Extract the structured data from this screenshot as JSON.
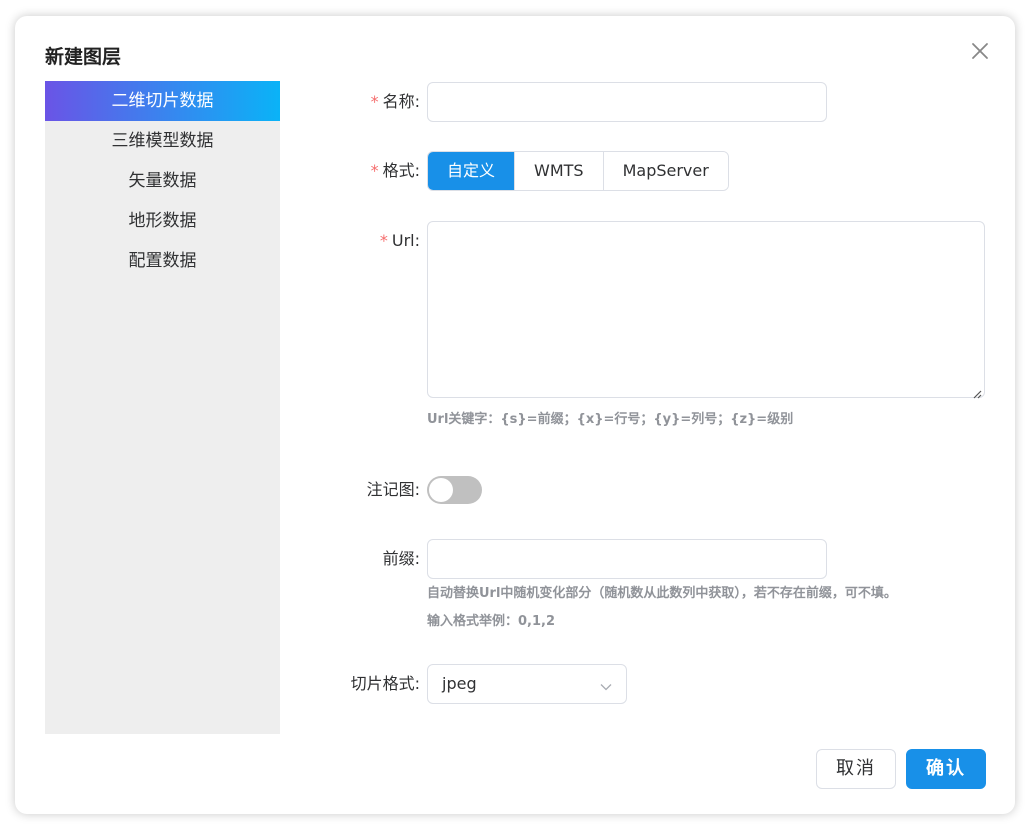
{
  "dialog": {
    "title": "新建图层",
    "close_icon": "close-icon"
  },
  "sidebar": {
    "items": [
      {
        "label": "二维切片数据",
        "active": true
      },
      {
        "label": "三维模型数据",
        "active": false
      },
      {
        "label": "矢量数据",
        "active": false
      },
      {
        "label": "地形数据",
        "active": false
      },
      {
        "label": "配置数据",
        "active": false
      }
    ],
    "active_gradient": [
      "#6a54e6",
      "#0ab3f7"
    ]
  },
  "form": {
    "required_mark": "*",
    "name": {
      "label": "名称:",
      "value": ""
    },
    "format": {
      "label": "格式:",
      "options": [
        "自定义",
        "WMTS",
        "MapServer"
      ],
      "selected": "自定义"
    },
    "url": {
      "label": "Url:",
      "value": "",
      "hint": "Url关键字：{s}=前缀；{x}=行号；{y}=列号；{z}=级别"
    },
    "annotation": {
      "label": "注记图:",
      "enabled": false
    },
    "prefix": {
      "label": "前缀:",
      "value": "",
      "hint1": "自动替换Url中随机变化部分（随机数从此数列中获取），若不存在前缀，可不填。",
      "hint2": "输入格式举例：0,1,2"
    },
    "tile_format": {
      "label": "切片格式:",
      "value": "jpeg",
      "arrow_icon": "chevron-down-icon"
    }
  },
  "footer": {
    "cancel_label": "取消",
    "confirm_label": "确认"
  },
  "colors": {
    "primary": "#1890e8",
    "required": "#f56c6c",
    "hint": "#909399"
  }
}
